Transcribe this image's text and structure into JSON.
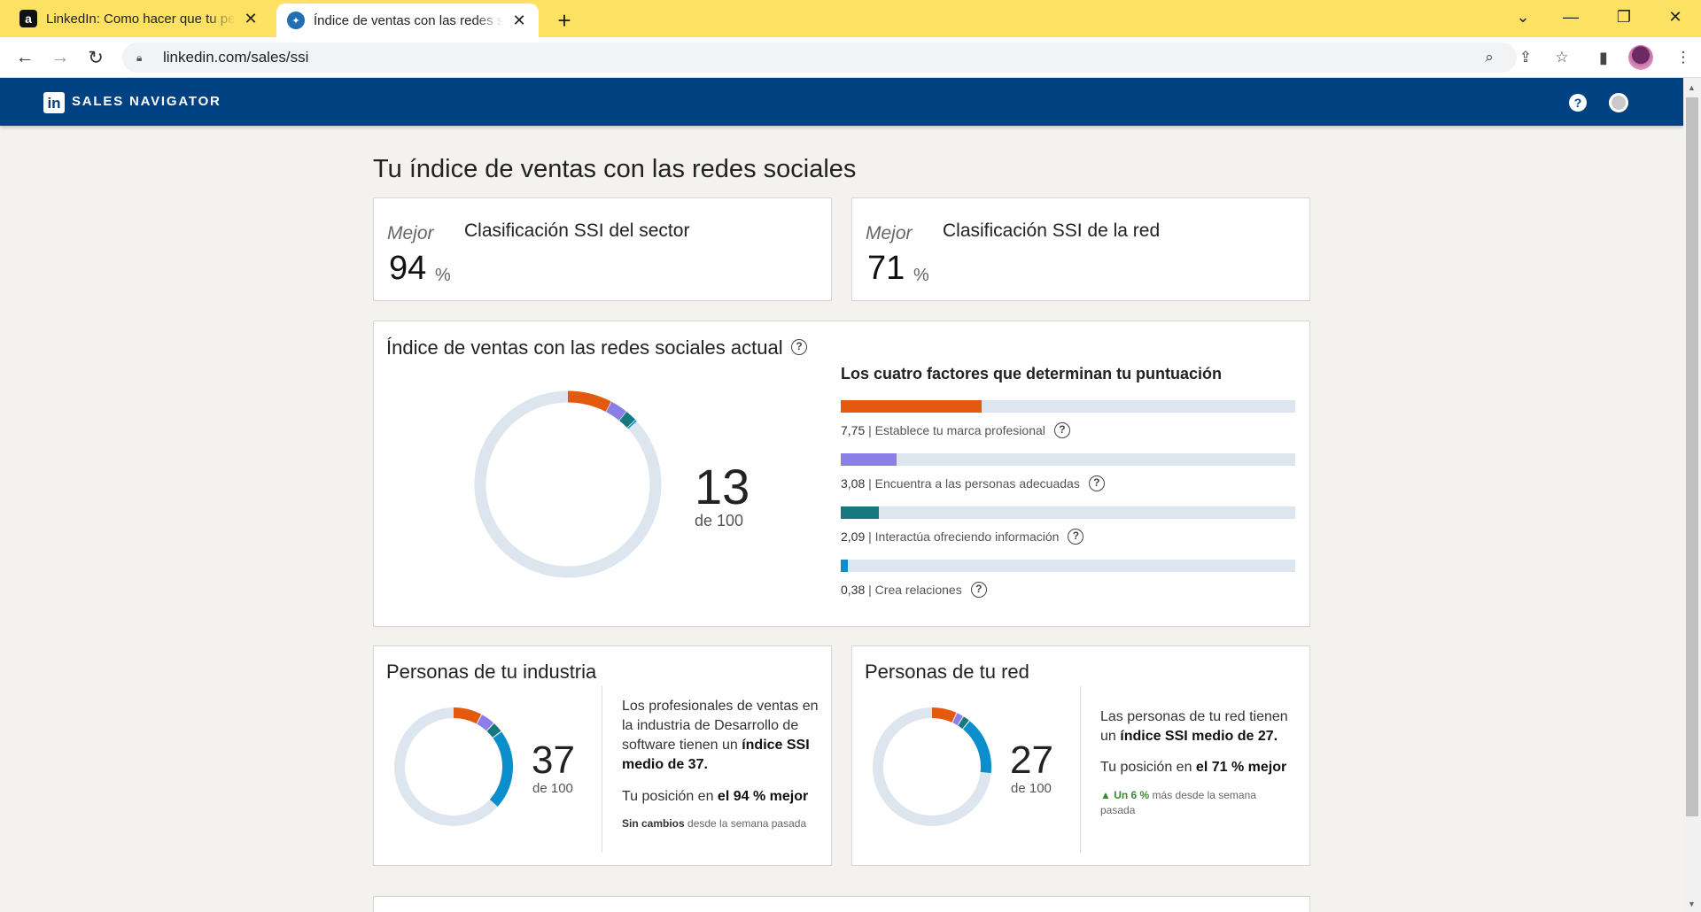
{
  "browser": {
    "tabs": [
      {
        "title": "LinkedIn: Como hacer que tu perfil",
        "close": "✕"
      },
      {
        "title": "Índice de ventas con las redes sociales",
        "close": "✕"
      }
    ],
    "new_tab": "+",
    "window_controls": {
      "dropdown": "⌄",
      "minimize": "—",
      "restore": "❐",
      "close": "✕"
    },
    "url": "linkedin.com/sales/ssi",
    "nav": {
      "back": "←",
      "forward": "→",
      "reload": "↻"
    }
  },
  "app": {
    "logo": "in",
    "brand": "SALES NAVIGATOR",
    "help": "?"
  },
  "page": {
    "title": "Tu índice de ventas con las redes sociales",
    "sector_rank": {
      "prefix": "Mejor",
      "title": "Clasificación SSI del sector",
      "value": "94",
      "unit": "%"
    },
    "network_rank": {
      "prefix": "Mejor",
      "title": "Clasificación SSI de la red",
      "value": "71",
      "unit": "%"
    },
    "current": {
      "title": "Índice de ventas con las redes sociales actual",
      "score": "13",
      "of": "de 100",
      "factors_title": "Los cuatro factores que determinan tu puntuación",
      "factors": [
        {
          "value": "7,75",
          "label": "Establece tu marca profesional",
          "max": 25,
          "color": "#e3590d"
        },
        {
          "value": "3,08",
          "label": "Encuentra a las personas adecuadas",
          "max": 25,
          "color": "#8b7ee8"
        },
        {
          "value": "2,09",
          "label": "Interactúa ofreciendo información",
          "max": 25,
          "color": "#16797e"
        },
        {
          "value": "0,38",
          "label": "Crea relaciones",
          "max": 25,
          "color": "#0a8fcc"
        }
      ],
      "donut": [
        7.75,
        3.08,
        2.09,
        0.38
      ]
    },
    "industry": {
      "title": "Personas de tu industria",
      "score": "37",
      "of": "de 100",
      "desc1_a": "Los profesionales de ventas en la industria de Desarrollo de software tienen un ",
      "desc1_b": "índice SSI medio de 37.",
      "desc2_a": "Tu posición en ",
      "desc2_b": "el 94 % mejor",
      "change_a": "Sin cambios",
      "change_b": " desde la semana pasada",
      "donut": [
        8,
        4,
        3,
        22
      ]
    },
    "network": {
      "title": "Personas de tu red",
      "score": "27",
      "of": "de 100",
      "desc1_a": "Las personas de tu red tienen un ",
      "desc1_b": "índice SSI medio de 27.",
      "desc2_a": "Tu posición en ",
      "desc2_b": "el 71 % mejor",
      "change_a": "▲ Un 6 %",
      "change_b": " más desde la semana pasada",
      "donut": [
        7,
        2,
        2,
        16
      ]
    }
  },
  "colors": {
    "brand": "#004182",
    "orange": "#e3590d",
    "purple": "#8b7ee8",
    "teal": "#16797e",
    "blue": "#0a8fcc",
    "track": "#dde6ee",
    "up": "#378a2f"
  }
}
